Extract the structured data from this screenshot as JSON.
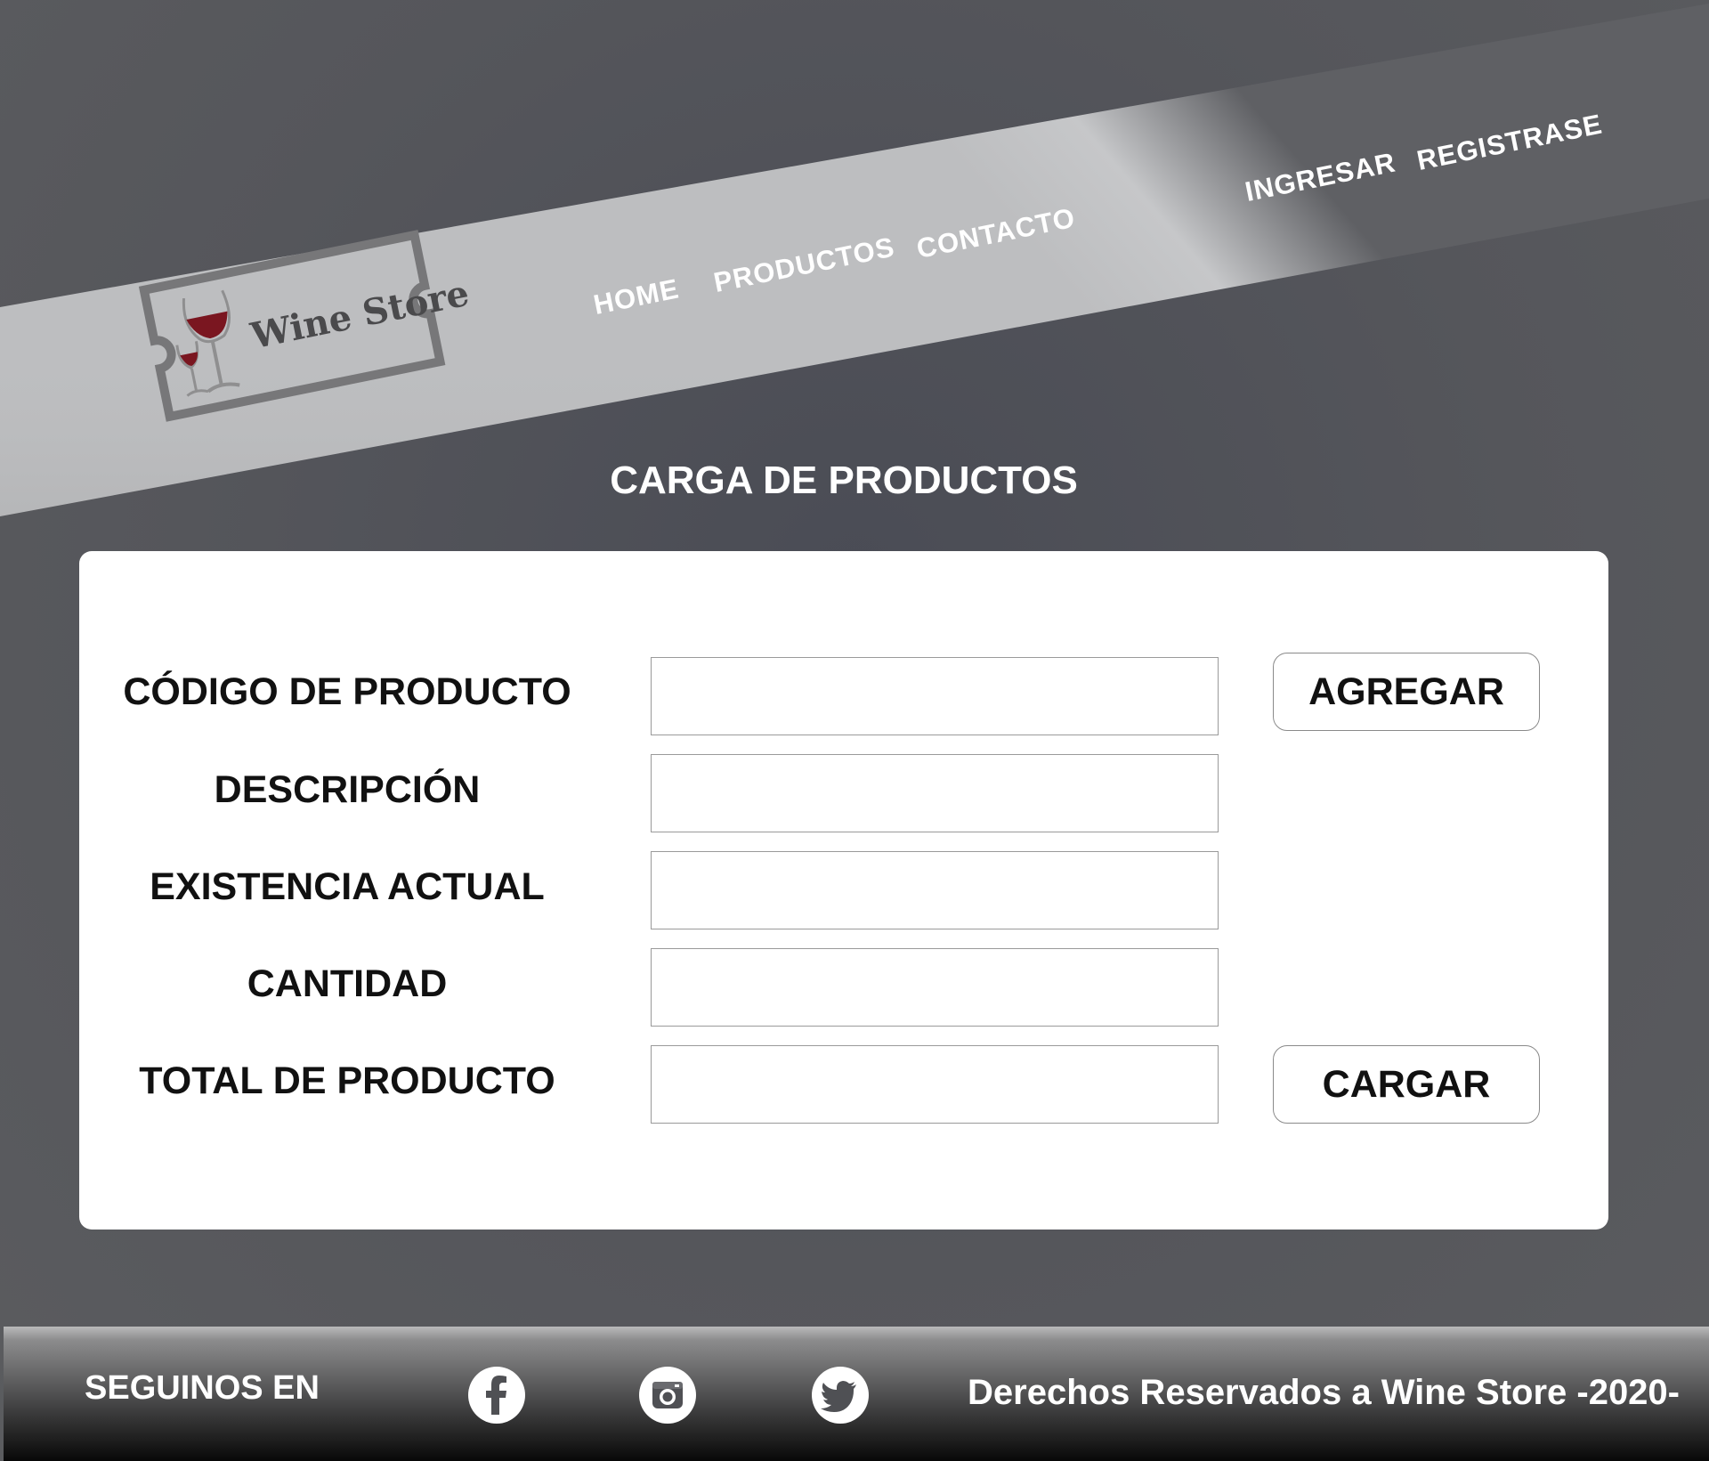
{
  "header": {
    "nav": {
      "home": "HOME",
      "products": "PRODUCTOS",
      "contact": "CONTACTO",
      "login": "INGRESAR",
      "register": "REGISTRASE"
    },
    "logo": {
      "text": "Wine Store",
      "icon": "wine-glasses-icon"
    }
  },
  "main": {
    "title": "CARGA DE PRODUCTOS",
    "form": {
      "fields": [
        {
          "label": "CÓDIGO DE PRODUCTO",
          "value": ""
        },
        {
          "label": "DESCRIPCIÓN",
          "value": ""
        },
        {
          "label": "EXISTENCIA ACTUAL",
          "value": ""
        },
        {
          "label": "CANTIDAD",
          "value": ""
        },
        {
          "label": "TOTAL DE PRODUCTO",
          "value": ""
        }
      ],
      "add_button": "AGREGAR",
      "submit_button": "CARGAR"
    }
  },
  "footer": {
    "follow_label": "SEGUINOS EN",
    "social": [
      {
        "name": "facebook-icon"
      },
      {
        "name": "instagram-icon"
      },
      {
        "name": "twitter-icon"
      }
    ],
    "copyright": "Derechos Reservados a Wine Store -2020-"
  },
  "colors": {
    "background": "#55565b",
    "band_light": "#bcbdbf",
    "band_dark": "#5e5f63",
    "card": "#ffffff",
    "wine": "#7a1620",
    "text_dark": "#111111"
  }
}
